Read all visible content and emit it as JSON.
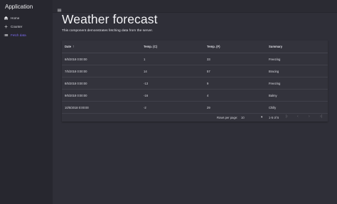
{
  "app": {
    "title": "Application"
  },
  "sidebar": {
    "items": [
      {
        "label": "Home",
        "icon": "home-icon"
      },
      {
        "label": "Counter",
        "icon": "plus-icon"
      },
      {
        "label": "Fetch data",
        "icon": "list-icon",
        "active": true
      }
    ]
  },
  "main": {
    "title": "Weather forecast",
    "description": "This component demonstrates fetching data from the server."
  },
  "table": {
    "columns": [
      "Date",
      "Temp. (C)",
      "Temp. (F)",
      "Summary"
    ],
    "sorted_column": "Date",
    "rows": [
      [
        "6/5/2018 0:00:00",
        "1",
        "33",
        "Freezing"
      ],
      [
        "7/5/2018 0:00:00",
        "14",
        "57",
        "Bracing"
      ],
      [
        "8/5/2018 0:00:00",
        "-13",
        "9",
        "Freezing"
      ],
      [
        "9/5/2018 0:00:00",
        "-16",
        "4",
        "Balmy"
      ],
      [
        "10/5/2018 0:00:00",
        "-2",
        "29",
        "Chilly"
      ]
    ]
  },
  "pagination": {
    "rows_per_page_label": "Rows per page:",
    "rows_per_page": "10",
    "range": "1-5 of 5"
  },
  "colors": {
    "accent": "#7d6cf2",
    "sidebar": "#27272f",
    "background": "#2f2f38",
    "card": "#33333c"
  }
}
